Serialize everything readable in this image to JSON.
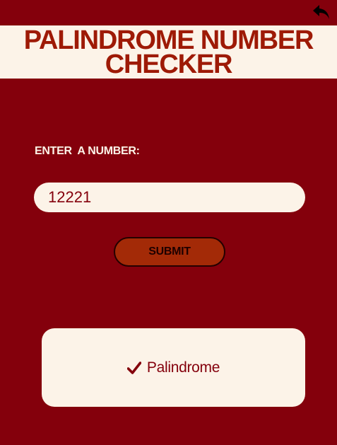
{
  "header": {
    "back_icon": "reply-arrow-icon",
    "title_line_1": "PALINDROME NUMBER",
    "title_line_2": "CHECKER"
  },
  "form": {
    "label": "ENTER  A NUMBER:",
    "input_value": "12221",
    "submit_label": "SUBMIT"
  },
  "result": {
    "icon": "check-icon",
    "text": "Palindrome"
  },
  "colors": {
    "background": "#84000c",
    "cream": "#fcf3e8",
    "title": "#9e1a06",
    "button": "#a32a07"
  }
}
